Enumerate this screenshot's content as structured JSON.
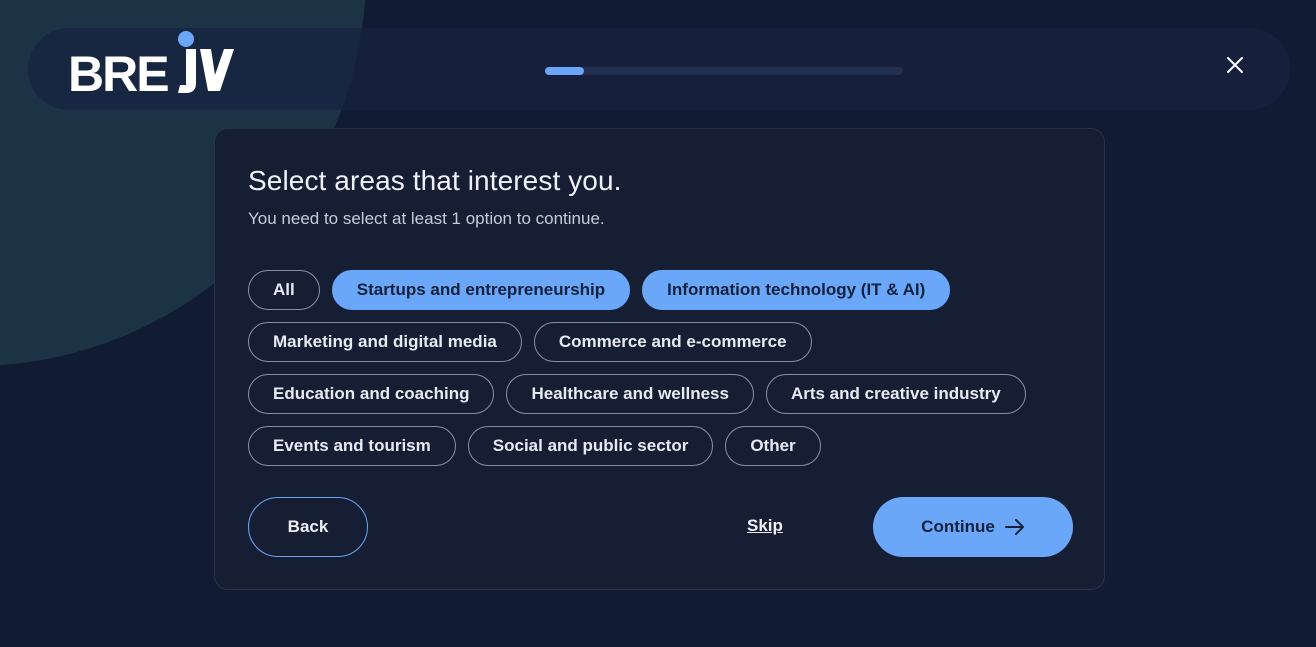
{
  "header": {
    "logo_text": "BREJV",
    "progress": 0.11,
    "close_icon": "close-icon"
  },
  "colors": {
    "accent": "#6aa7f8",
    "background": "#121b34",
    "card": "#161e33",
    "chip_border": "#8791a6"
  },
  "card": {
    "title": "Select areas that interest you.",
    "subtitle": "You need to select at least 1 option to continue."
  },
  "options": [
    {
      "label": "All",
      "selected": false
    },
    {
      "label": "Startups and entrepreneurship",
      "selected": true
    },
    {
      "label": "Information technology (IT & AI)",
      "selected": true
    },
    {
      "label": "Marketing and digital media",
      "selected": false
    },
    {
      "label": "Commerce and e-commerce",
      "selected": false
    },
    {
      "label": "Education and coaching",
      "selected": false
    },
    {
      "label": "Healthcare and wellness",
      "selected": false
    },
    {
      "label": "Arts and creative industry",
      "selected": false
    },
    {
      "label": "Events and tourism",
      "selected": false
    },
    {
      "label": "Social and public sector",
      "selected": false
    },
    {
      "label": "Other",
      "selected": false
    }
  ],
  "actions": {
    "back_label": "Back",
    "skip_label": "Skip",
    "continue_label": "Continue",
    "continue_icon": "arrow-right-icon"
  }
}
